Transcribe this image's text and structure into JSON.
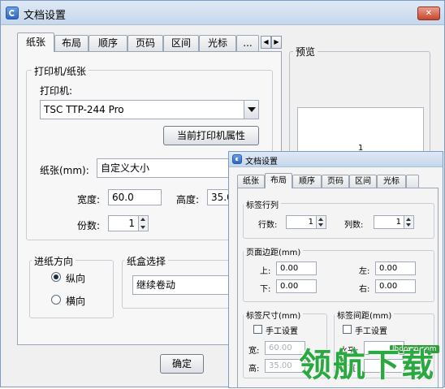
{
  "main_window": {
    "title": "文档设置",
    "close_label": "✕",
    "tabs": [
      "纸张",
      "布局",
      "顺序",
      "页码",
      "区间",
      "光标",
      "..."
    ],
    "active_tab": "纸张",
    "tab_scroll_left": "◀",
    "tab_scroll_right": "▶",
    "printer_group": {
      "title": "打印机/纸张",
      "printer_label": "打印机:",
      "printer_value": "TSC TTP-244 Pro",
      "properties_button": "当前打印机属性",
      "paper_label": "纸张(mm):",
      "paper_value": "自定义大小",
      "width_label": "宽度:",
      "width_value": "60.0",
      "height_label": "高度:",
      "height_value": "35.0",
      "copies_label": "份数:",
      "copies_value": "1"
    },
    "feed_group": {
      "title": "进纸方向",
      "portrait": "纵向",
      "landscape": "横向",
      "selected": "纵向"
    },
    "tray_group": {
      "title": "纸盒选择",
      "value": "继续卷动"
    },
    "preview": {
      "title": "预览",
      "page_number": "1"
    },
    "ok_button": "确定"
  },
  "overlay_window": {
    "title": "文档设置",
    "tabs": [
      "纸张",
      "布局",
      "顺序",
      "页码",
      "区间",
      "光标"
    ],
    "active_tab": "布局",
    "label_rows": {
      "title": "标签行列",
      "rows_label": "行数:",
      "rows_value": "1",
      "cols_label": "列数:",
      "cols_value": "1"
    },
    "margins": {
      "title": "页面边距(mm)",
      "top_label": "上:",
      "top_value": "0.00",
      "left_label": "左:",
      "left_value": "0.00",
      "bottom_label": "下:",
      "bottom_value": "0.00",
      "right_label": "右:",
      "right_value": "0.00"
    },
    "label_size": {
      "title": "标签尺寸(mm)",
      "manual_label": "手工设置",
      "width_label": "宽:",
      "width_value": "60.00",
      "height_label": "高:",
      "height_value": "35.00"
    },
    "label_gap": {
      "title": "标签间距(mm)",
      "manual_label": "手工设置",
      "horizontal_label": "水平:",
      "vertical_label": "垂直:"
    }
  },
  "watermark": {
    "text": "领航下载",
    "site": "lhdown.com"
  }
}
